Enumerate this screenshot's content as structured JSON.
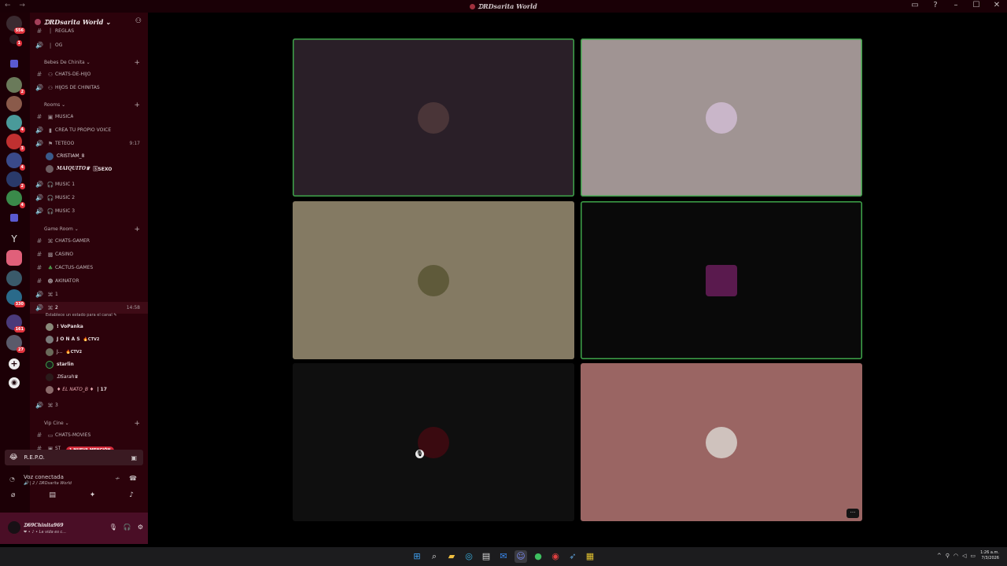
{
  "titlebar": {
    "nav": "← →",
    "title": "ᗪRDsarita World",
    "controls": [
      "▭",
      "?",
      "–",
      "☐",
      "✕"
    ]
  },
  "colors": {
    "sidebar_bg": "#2c020b",
    "rail_bg": "#1c0006",
    "speaking_border": "#3ea54a",
    "mention_badge": "#d42a3a",
    "user_panel_bg": "#4a0e26"
  },
  "rail": {
    "badges": [
      "556",
      "1",
      "2",
      "4",
      "3",
      "4",
      "2",
      "4",
      "330",
      "161",
      "27"
    ]
  },
  "server": {
    "name": "ᗪRDsarita World ⌄"
  },
  "channels": {
    "c_reglas": "REGLAS",
    "c_og": "OG",
    "cat_bebes": "Bebes De Chinita ⌄",
    "c_chats_de_hijo": "CHATS-DE-HIJO",
    "c_hijos_chinitas": "HIJOS DE CHINITAS",
    "cat_rooms": "Rooms ⌄",
    "c_musica": "MUSICA",
    "c_crea_voice": "CREA TU PROPIO VOICE",
    "c_tereoo": "TETEOO",
    "c_tereoo_time": "9:17",
    "u_cristian": "CRISTIAM_8",
    "u_maquito": "MAIQUITO♛",
    "u_maquito_tag": "🅂SEXO",
    "c_music1": "MUSIC 1",
    "c_music2": "MUSIC 2",
    "c_music3": "MUSIC 3",
    "cat_game": "Game Room ⌄",
    "c_chats_gamer": "CHATS-GAMER",
    "c_casino": "CASINO",
    "c_cactus": "CACTUS-GAMES",
    "c_akinator": "AKINATOR",
    "c_1": "1",
    "c_2": "2",
    "c_2_time": "14:58",
    "c_2_status": "Establece un estado para el canal ✎",
    "u_vopanka": "! VoPanka",
    "u_jonas": "J O N A S",
    "u_jonas_tag": "🔥CTV2",
    "u_j": "J...",
    "u_j_tag": "🔥CTV2",
    "u_starlin": "starlin",
    "u_sarah": "ᗪSarah♛",
    "u_elnato": "♦ EL NATO_B ♦",
    "u_elnato_tag": "| 17",
    "c_3": "3",
    "cat_vip": "Vip Cine ⌄",
    "c_chats_movies": "CHATS-MOVIES",
    "c_st": "ST",
    "mention_badge": "1 NUEVA MENCIÓN"
  },
  "activity": {
    "icon": "😂",
    "name": "R.E.P.O."
  },
  "voice_panel": {
    "status": "Voz conectada",
    "channel": "🔊 | 2 / ᗪRDsarita World"
  },
  "user_panel": {
    "name": "ᗪ69Chinita969",
    "status": "❤ • ♪ • La vida es c..."
  },
  "tiles": [
    {
      "bg": "#2a1f28",
      "speaking": true,
      "avatar": "#4a3538"
    },
    {
      "bg": "#a09493",
      "speaking": true,
      "avatar": "#c9b6c9"
    },
    {
      "bg": "#847a63",
      "speaking": false,
      "avatar": "#5f5a3a"
    },
    {
      "bg": "#090909",
      "speaking": true,
      "avatar": "#5a1a4e"
    },
    {
      "bg": "#0f0f0f",
      "speaking": false,
      "avatar": "#3a0a10"
    },
    {
      "bg": "#9a6563",
      "speaking": false,
      "avatar": "#cfc2bd"
    }
  ],
  "more_button": "···",
  "taskbar": {
    "time": "1:26 a.m.",
    "date": "7/3/2026"
  }
}
